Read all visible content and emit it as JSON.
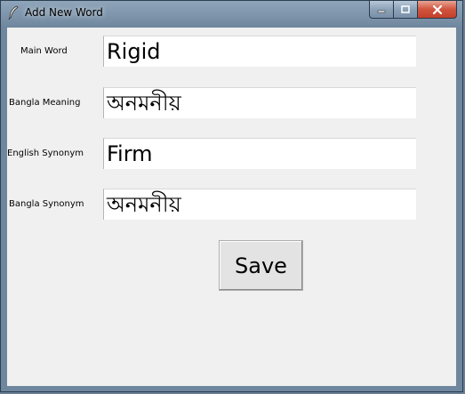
{
  "window": {
    "title": "Add New Word",
    "icon": "feather-icon",
    "controls": {
      "minimize": "minimize-icon",
      "maximize": "maximize-icon",
      "close": "close-icon"
    }
  },
  "form": {
    "main_word_label": "Main Word",
    "main_word_value": "Rigid",
    "bangla_meaning_label": "Bangla Meaning",
    "bangla_meaning_value": "অনমনীয়",
    "english_synonym_label": "English Synonym",
    "english_synonym_value": "Firm",
    "bangla_synonym_label": "Bangla Synonym",
    "bangla_synonym_value": "অনমনীয়",
    "save_label": "Save"
  },
  "colors": {
    "client_background": "#f0f0f0",
    "entry_background": "#ffffff",
    "close_button": "#c7432d"
  }
}
